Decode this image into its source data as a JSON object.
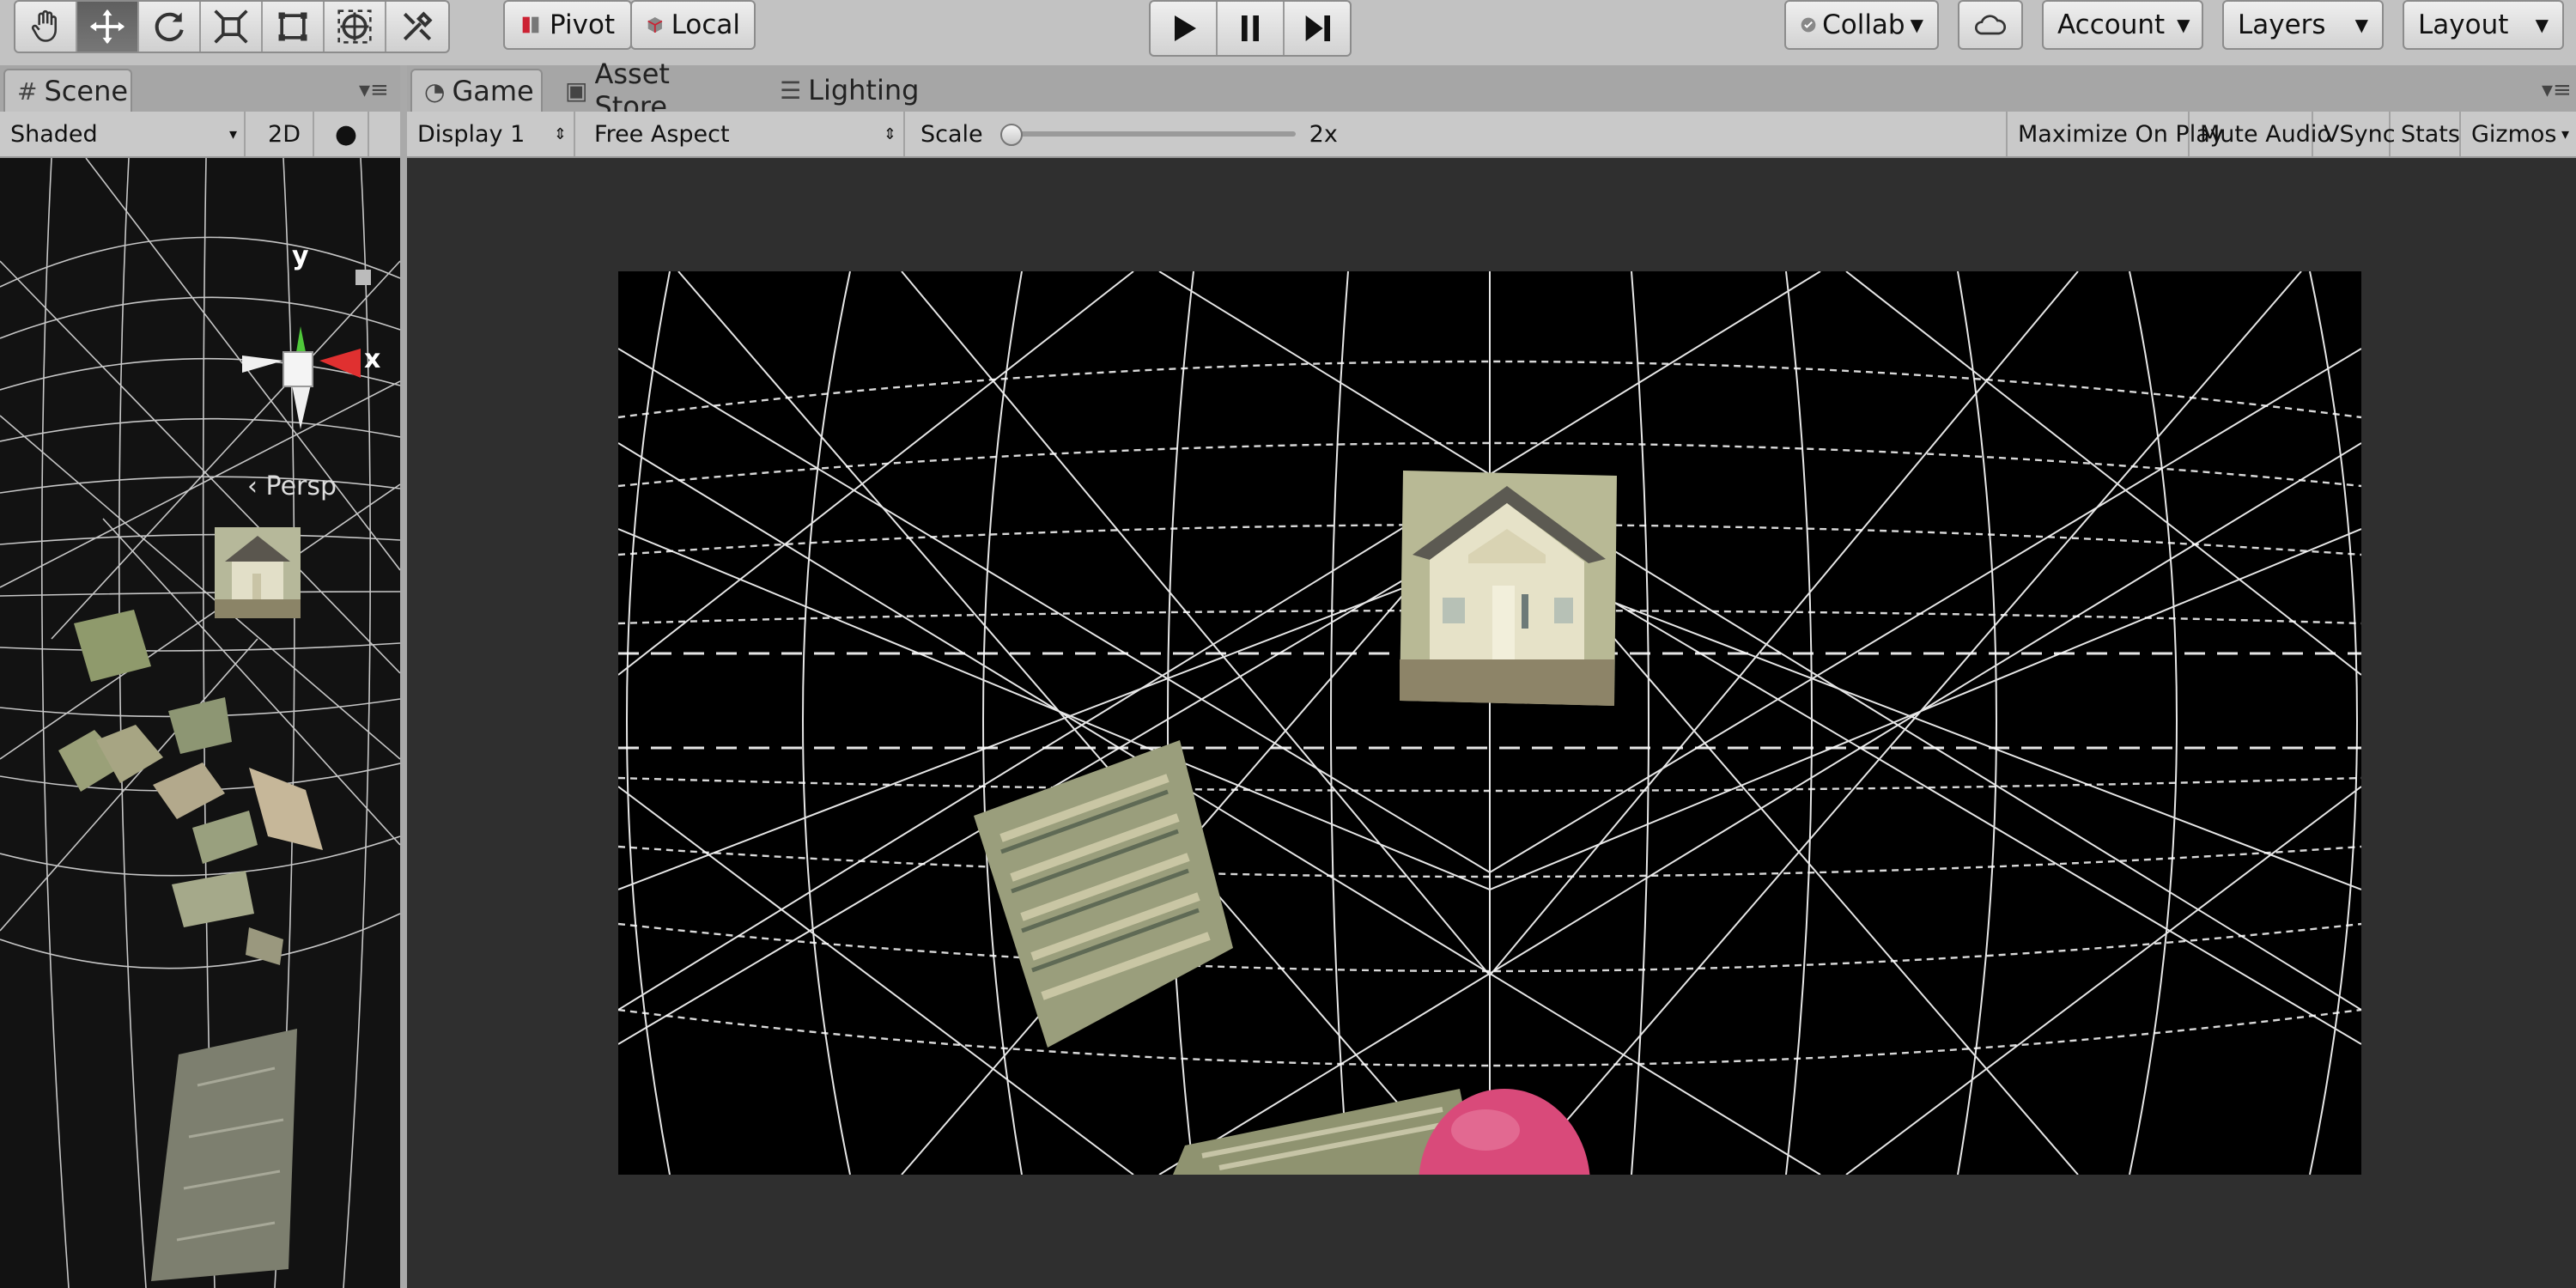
{
  "toolbar": {
    "tools": [
      "hand-icon",
      "move-icon",
      "rotate-icon",
      "scale-icon",
      "rect-transform-icon",
      "transform-icon",
      "custom-tool-icon"
    ],
    "pivot_label": "Pivot",
    "local_label": "Local",
    "play_controls": [
      "play-icon",
      "pause-icon",
      "step-icon"
    ],
    "collab_label": "Collab",
    "account_label": "Account",
    "layers_label": "Layers",
    "layout_label": "Layout"
  },
  "scene_panel": {
    "tab_label": "Scene",
    "shading_mode": "Shaded",
    "mode_2d_label": "2D",
    "gizmo": {
      "y_label": "y",
      "x_label": "x",
      "projection_label": "Persp"
    }
  },
  "game_panel": {
    "tabs": [
      {
        "label": "Game",
        "icon": "pacman-icon",
        "active": true
      },
      {
        "label": "Asset Store",
        "icon": "store-icon",
        "active": false
      },
      {
        "label": "Lighting",
        "icon": "lighting-icon",
        "active": false
      }
    ],
    "display_label": "Display 1",
    "aspect_label": "Free Aspect",
    "scale_label": "Scale",
    "scale_value": "2x",
    "scale_slider_fraction": 0.0,
    "options": [
      "Maximize On Play",
      "Mute Audio",
      "VSync",
      "Stats",
      "Gizmos"
    ]
  },
  "colors": {
    "editor_bg": "#c2c2c2",
    "game_area_bg": "#2f2f2f",
    "viewport_bg": "#000000",
    "grid_lines": "#ffffff",
    "sphere": "#d94a7a",
    "gizmo_y": "#4fc83a",
    "gizmo_x": "#e03030"
  }
}
